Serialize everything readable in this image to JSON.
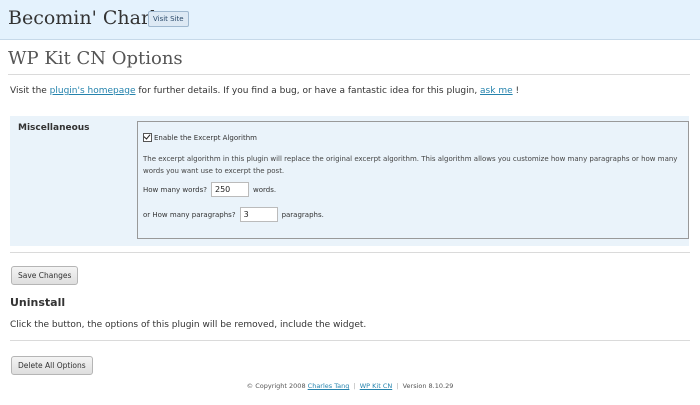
{
  "header": {
    "site_title": "Becomin' Charles",
    "visit_site": "Visit Site"
  },
  "page_title": "WP Kit CN Options",
  "intro": {
    "before": "Visit the ",
    "homepage_link": "plugin's homepage",
    "middle": " for further details. If you find a bug, or have a fantastic idea for this plugin, ",
    "ask_link": "ask me",
    "after": " !"
  },
  "misc": {
    "label": "Miscellaneous",
    "checkbox_label": "Enable the Excerpt Algorithm",
    "checkbox_checked": true,
    "description": "The excerpt algorithm in this plugin will replace the original excerpt algorithm. This algorithm allows you customize how many paragraphs or how many words you want use to excerpt the post.",
    "words_label": "How many words?",
    "words_value": "250",
    "words_suffix": "words.",
    "paragraphs_label": "or How many paragraphs?",
    "paragraphs_value": "3",
    "paragraphs_suffix": "paragraphs."
  },
  "save_button": "Save Changes",
  "uninstall": {
    "heading": "Uninstall",
    "text": "Click the button, the options of this plugin will be removed, include the widget.",
    "button": "Delete All Options"
  },
  "footer": {
    "copyright": "© Copyright 2008",
    "author_link": "Charles Tang",
    "sep": "|",
    "plugin_link": "WP Kit CN",
    "version": "Version 8.10.29"
  }
}
